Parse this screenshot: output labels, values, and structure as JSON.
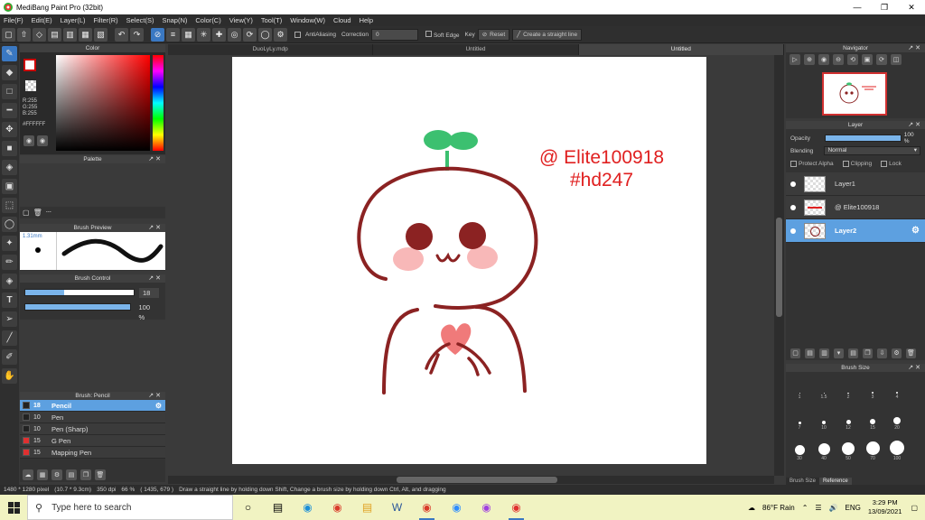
{
  "window": {
    "title": "MediBang Paint Pro (32bit)"
  },
  "menu": [
    "File(F)",
    "Edit(E)",
    "Layer(L)",
    "Filter(R)",
    "Select(S)",
    "Snap(N)",
    "Color(C)",
    "View(Y)",
    "Tool(T)",
    "Window(W)",
    "Cloud",
    "Help"
  ],
  "toolbar": {
    "antialias_label": "AntiAliasing",
    "correction_label": "Correction",
    "correction_value": "0",
    "soft_edge_label": "Soft Edge",
    "key_label": "Key",
    "reset_label": "Reset",
    "straight_line_label": "Create a straight line"
  },
  "color_panel": {
    "title": "Color",
    "rgb": [
      "R:255",
      "G:255",
      "B:255"
    ],
    "hex": "#FFFFFF",
    "fg_color": "#ffffff",
    "fg_border": "#cc0000"
  },
  "palette_panel": {
    "title": "Palette",
    "footer_text": "---"
  },
  "brush_preview": {
    "title": "Brush Preview",
    "size": "1.31mm"
  },
  "brush_control": {
    "title": "Brush Control",
    "size_value": "18",
    "opacity_value": "100 %",
    "size_fill": 0.36,
    "opacity_fill": 1.0
  },
  "brush_list": {
    "title": "Brush: Pencil",
    "items": [
      {
        "size": "18",
        "name": "Pencil",
        "color": "#222222",
        "selected": true
      },
      {
        "size": "10",
        "name": "Pen",
        "color": "#222222"
      },
      {
        "size": "10",
        "name": "Pen (Sharp)",
        "color": "#222222"
      },
      {
        "size": "15",
        "name": "G Pen",
        "color": "#e03030"
      },
      {
        "size": "15",
        "name": "Mapping Pen",
        "color": "#e03030"
      }
    ]
  },
  "tabs": [
    "DuoLyLy.mdp",
    "Untitled",
    "Untitled"
  ],
  "canvas": {
    "watermark_line1": "@ Elite100918",
    "watermark_line2": "#hd247",
    "watermark_color": "#e02020",
    "outline_color": "#8b2222",
    "sprout_color": "#3cc070",
    "heart_color": "#f07a7a",
    "blush_color": "#f6a0a0"
  },
  "navigator": {
    "title": "Navigator"
  },
  "layer_panel": {
    "title": "Layer",
    "opacity_label": "Opacity",
    "opacity_value": "100 %",
    "blending_label": "Blending",
    "blending_value": "Normal",
    "protect_alpha": "Protect Alpha",
    "clipping": "Clipping",
    "lock": "Lock",
    "layers": [
      {
        "name": "Layer1"
      },
      {
        "name": "@ Elite100918"
      },
      {
        "name": "Layer2",
        "selected": true
      }
    ]
  },
  "brush_size_panel": {
    "title": "Brush Size",
    "sizes": [
      "1",
      "1.5",
      "2",
      "3",
      "4",
      "7",
      "10",
      "12",
      "15",
      "20",
      "30",
      "40",
      "50",
      "70",
      "100"
    ],
    "tabs": [
      "Brush Size",
      "Reference"
    ]
  },
  "status": {
    "dims": "1480 * 1280 pixel",
    "cm": "(10.7 * 9.3cm)",
    "dpi": "350 dpi",
    "zoom": "66 %",
    "coords": "( 1435, 679 )",
    "hint": "Draw a straight line by holding down Shift, Change a brush size by holding down Ctrl, Alt, and dragging"
  },
  "taskbar": {
    "search_placeholder": "Type here to search",
    "weather": "86°F Rain",
    "lang": "ENG",
    "time": "3:29 PM",
    "date": "13/09/2021"
  }
}
